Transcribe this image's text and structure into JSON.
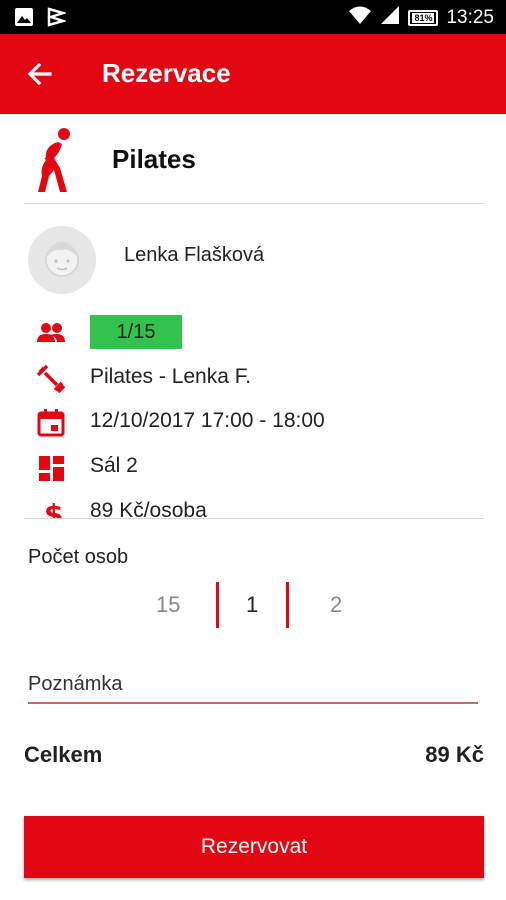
{
  "status_bar": {
    "time": "13:25",
    "battery_percent": "81%",
    "icons": [
      "image-notification-icon",
      "app-notification-icon",
      "wifi-icon",
      "cellular-signal-icon",
      "battery-icon"
    ]
  },
  "app_bar": {
    "title": "Rezervace",
    "back_icon": "arrow-back-icon"
  },
  "event": {
    "name": "Pilates",
    "trainer": "Lenka Flašková",
    "capacity": "1/15",
    "lesson": "Pilates - Lenka F.",
    "datetime": "12/10/2017 17:00 - 18:00",
    "room": "Sál 2",
    "price": "89 Kč/osoba"
  },
  "form": {
    "persons_label": "Počet osob",
    "persons_options": [
      "15",
      "1",
      "2"
    ],
    "persons_selected": "1",
    "note_label": "Poznámka"
  },
  "summary": {
    "total_label": "Celkem",
    "total_value": "89 Kč"
  },
  "actions": {
    "reserve_label": "Rezervovat"
  },
  "colors": {
    "accent": "#e30613",
    "capacity_badge": "#33c24d",
    "status_bar": "#000000"
  }
}
